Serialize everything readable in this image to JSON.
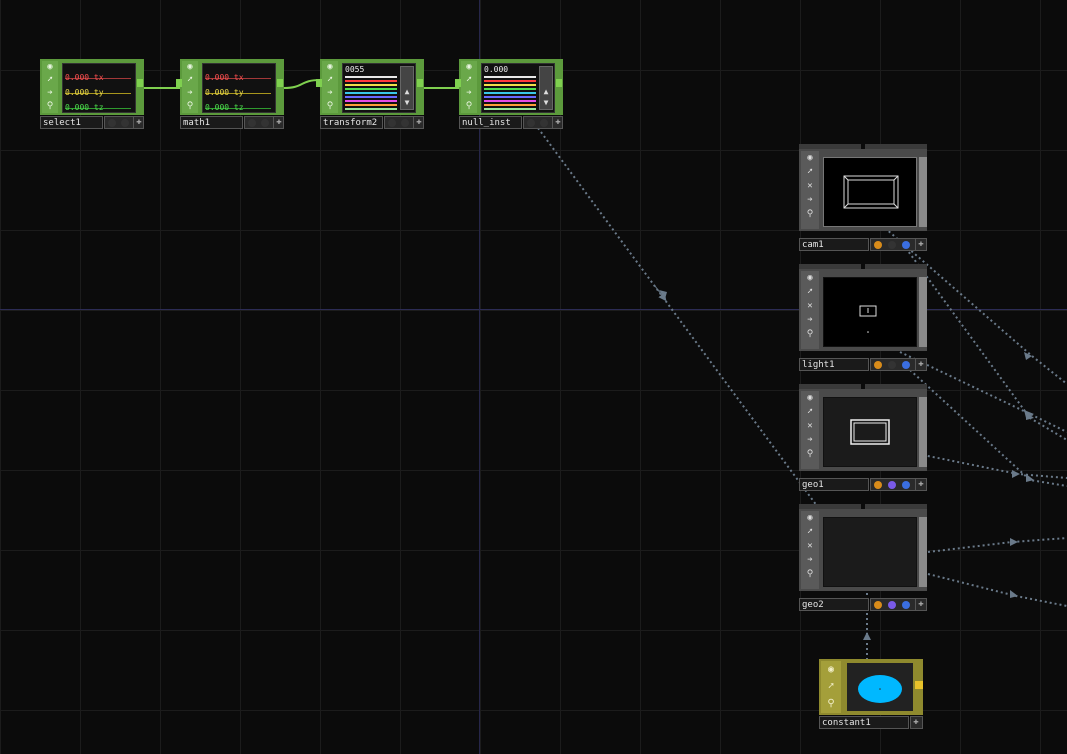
{
  "network": {
    "colors": {
      "background": "#0b0b0b",
      "chop_node": "#5c9a3c",
      "comp_node": "#4a4a4a",
      "top_node": "#8f8a2e",
      "wire_chop": "#7fd04f",
      "wire_ref": "#6a7a8a"
    },
    "chop_nodes": [
      {
        "name": "select1",
        "channels": [
          "tx",
          "ty",
          "tz"
        ],
        "values": [
          "0.000",
          "0.000",
          "0.000"
        ],
        "viewer": "channel-bars",
        "colors": [
          "#ff4040",
          "#ffd700",
          "#40ff40"
        ]
      },
      {
        "name": "math1",
        "channels": [
          "tx",
          "ty",
          "tz"
        ],
        "values": [
          "0.000",
          "0.000",
          "0.000"
        ],
        "viewer": "channel-bars",
        "colors": [
          "#ff4040",
          "#ffd700",
          "#40ff40"
        ]
      },
      {
        "name": "transform2",
        "viewer": "channel-list",
        "header_value": "0055"
      },
      {
        "name": "null_inst",
        "viewer": "channel-list",
        "header_value": "0.000"
      }
    ],
    "comp_nodes": [
      {
        "name": "cam1",
        "icon": "camera-icon",
        "type_icons": [
          "render-flag",
          "viewer-flag",
          "instance-flag"
        ]
      },
      {
        "name": "light1",
        "icon": "light-icon",
        "type_icons": [
          "render-flag",
          "viewer-flag",
          "instance-flag"
        ]
      },
      {
        "name": "geo1",
        "icon": "geometry-icon",
        "type_icons": [
          "render-flag",
          "material-flag",
          "instance-flag"
        ]
      },
      {
        "name": "geo2",
        "icon": "geometry-icon",
        "type_icons": [
          "render-flag",
          "material-flag",
          "instance-flag"
        ]
      }
    ],
    "top_nodes": [
      {
        "name": "constant1",
        "preview_color": "#00b8ff"
      }
    ]
  }
}
